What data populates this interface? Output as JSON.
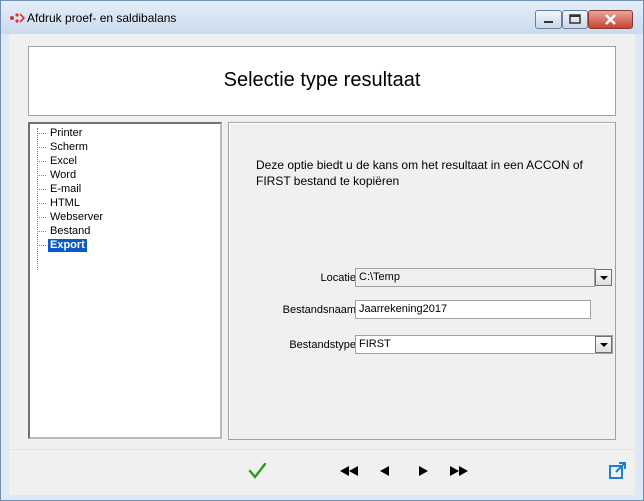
{
  "window": {
    "title": "Afdruk proef- en saldibalans"
  },
  "header": {
    "title": "Selectie type resultaat"
  },
  "tree": {
    "items": [
      {
        "label": "Printer"
      },
      {
        "label": "Scherm"
      },
      {
        "label": "Excel"
      },
      {
        "label": "Word"
      },
      {
        "label": "E-mail"
      },
      {
        "label": "HTML"
      },
      {
        "label": "Webserver"
      },
      {
        "label": "Bestand"
      },
      {
        "label": "Export",
        "selected": true
      }
    ]
  },
  "content": {
    "description": "Deze optie biedt u de kans om het resultaat in een ACCON of FIRST bestand te kopiëren",
    "locatie": {
      "label": "Locatie",
      "value": "C:\\Temp"
    },
    "bestandsnaam": {
      "label": "Bestandsnaam",
      "value": "Jaarrekening2017"
    },
    "bestandstype": {
      "label": "Bestandstype",
      "value": "FIRST"
    }
  },
  "toolbar": {
    "buttons": [
      "check-icon",
      "first-icon",
      "previous-icon",
      "next-icon",
      "last-icon",
      "open-external-icon"
    ],
    "accent_green": "#2a9a1c",
    "accent_blue": "#1f7fd8"
  }
}
